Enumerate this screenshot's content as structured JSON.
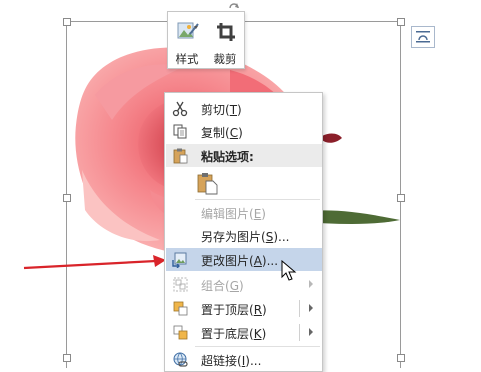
{
  "mini_toolbar": {
    "style_label": "样式",
    "crop_label": "裁剪"
  },
  "context_menu": {
    "cut": {
      "label": "剪切",
      "key": "T"
    },
    "copy": {
      "label": "复制",
      "key": "C"
    },
    "paste_options": {
      "label": "粘贴选项:"
    },
    "edit_picture": {
      "label": "编辑图片",
      "key": "E"
    },
    "save_as_picture": {
      "label": "另存为图片",
      "key": "S",
      "suffix": "..."
    },
    "change_picture": {
      "label": "更改图片",
      "key": "A",
      "suffix": "..."
    },
    "group": {
      "label": "组合",
      "key": "G"
    },
    "bring_to_front": {
      "label": "置于顶层",
      "key": "R"
    },
    "send_to_back": {
      "label": "置于底层",
      "key": "K"
    },
    "hyperlink": {
      "label": "超链接",
      "key": "I",
      "suffix": "..."
    }
  },
  "colors": {
    "highlight": "#c5d5ea",
    "pointer_arrow": "#d9242a",
    "rose": "#f07e84",
    "stem": "#4e6b35"
  }
}
